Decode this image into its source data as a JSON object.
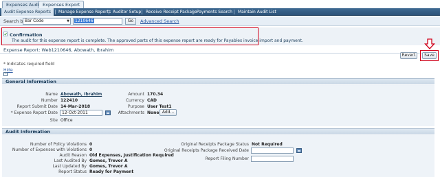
{
  "app_tabs": [
    {
      "label": "Expenses Audit",
      "active": true
    },
    {
      "label": "Expenses Export",
      "active": false
    }
  ],
  "subnav": [
    {
      "label": "Audit Expense Reports",
      "active": true
    },
    {
      "label": "Manage Expense Reports"
    },
    {
      "label": "Auditor Setup"
    },
    {
      "label": "Receive Receipt Package"
    },
    {
      "label": "Payments Search"
    },
    {
      "label": "Maintain Audit List"
    }
  ],
  "search": {
    "label": "Search by",
    "by_value": "Bar Code",
    "input_value": "1210646",
    "go_label": "Go",
    "advanced_label": "Advanced Search"
  },
  "confirmation": {
    "title": "Confirmation",
    "message": "The audit for this expense report is complete. The approved parts of this expense report are ready for Payables invoice import and payment."
  },
  "report_line": "Expense Report: Web1210646, Abowath, Ibrahim",
  "buttons": {
    "revert": "Revert",
    "save": "Save"
  },
  "required_note": "* Indicates required field",
  "hide_label": "Hide",
  "general": {
    "title": "General Information",
    "name_label": "Name",
    "name_value": "Abowath, Ibrahim",
    "number_label": "Number",
    "number_value": "122410",
    "submit_label": "Report Submit Date",
    "submit_value": "14-Mar-2018",
    "expdate_label": "* Expense Report Date",
    "expdate_value": "12-Oct-2011",
    "site_label": "Site",
    "site_value": "Office",
    "amount_label": "Amount",
    "amount_value": "170.34",
    "currency_label": "Currency",
    "currency_value": "CAD",
    "purpose_label": "Purpose",
    "purpose_value": "User Test1",
    "attach_label": "Attachments",
    "attach_value": "None",
    "add_label": "Add..."
  },
  "audit": {
    "title": "Audit Information",
    "policy_label": "Number of Policy Violations",
    "policy_value": "0",
    "expviol_label": "Number of Expenses with Violations",
    "expviol_value": "0",
    "reason_label": "Audit Reason",
    "reason_value": "Old Expenses, Justification Required",
    "lastaudit_label": "Last Audited By",
    "lastaudit_value": "Gomes, Trevor A",
    "lastupd_label": "Last Updated By",
    "lastupd_value": "Gomes, Trevor A",
    "status_label": "Report Status",
    "status_value": "Ready for Payment",
    "origstatus_label": "Original Receipts Package Status",
    "origstatus_value": "Not Required",
    "origdate_label": "Original Receipts Package Received Date",
    "filing_label": "Report Filing Number"
  },
  "colors": {
    "nav": "#2b5278",
    "highlight": "#d0021b",
    "section": "#c8d6e5"
  }
}
